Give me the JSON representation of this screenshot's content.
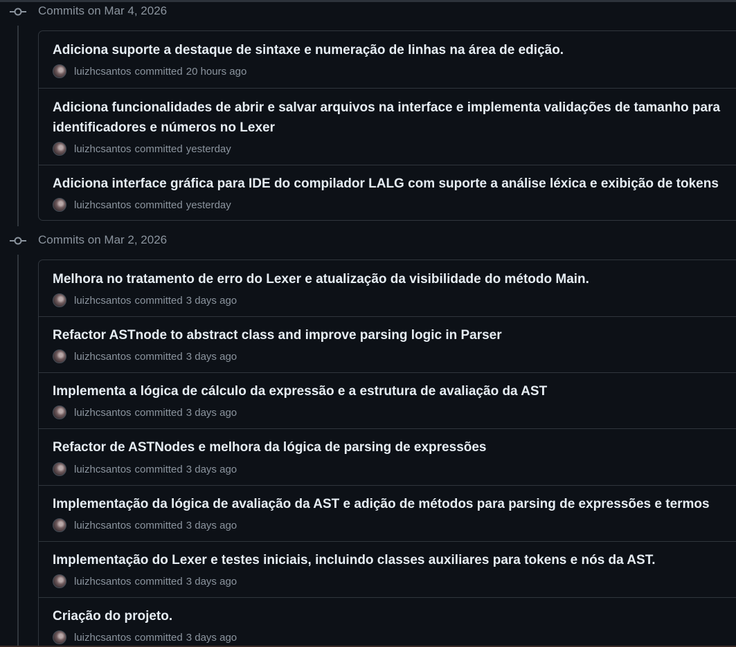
{
  "groups": [
    {
      "title": "Commits on Mar 4, 2026",
      "commits": [
        {
          "message": "Adiciona suporte a destaque de sintaxe e numeração de linhas na área de edição.",
          "author": "luizhcsantos",
          "verb": "committed",
          "time": "20 hours ago"
        },
        {
          "message": "Adiciona funcionalidades de abrir e salvar arquivos na interface e implementa validações de tamanho para identificadores e números no Lexer",
          "author": "luizhcsantos",
          "verb": "committed",
          "time": "yesterday"
        },
        {
          "message": "Adiciona interface gráfica para IDE do compilador LALG com suporte a análise léxica e exibição de tokens",
          "author": "luizhcsantos",
          "verb": "committed",
          "time": "yesterday"
        }
      ]
    },
    {
      "title": "Commits on Mar 2, 2026",
      "commits": [
        {
          "message": "Melhora no tratamento de erro do Lexer e atualização da visibilidade do método Main.",
          "author": "luizhcsantos",
          "verb": "committed",
          "time": "3 days ago"
        },
        {
          "message": "Refactor ASTnode to abstract class and improve parsing logic in Parser",
          "author": "luizhcsantos",
          "verb": "committed",
          "time": "3 days ago"
        },
        {
          "message": "Implementa a lógica de cálculo da expressão e a estrutura de avaliação da AST",
          "author": "luizhcsantos",
          "verb": "committed",
          "time": "3 days ago"
        },
        {
          "message": "Refactor de ASTNodes e melhora da lógica de parsing de expressões",
          "author": "luizhcsantos",
          "verb": "committed",
          "time": "3 days ago"
        },
        {
          "message": "Implementação da lógica de avaliação da AST e adição de métodos para parsing de expressões e termos",
          "author": "luizhcsantos",
          "verb": "committed",
          "time": "3 days ago"
        },
        {
          "message": "Implementação do Lexer e testes iniciais, incluindo classes auxiliares para tokens e nós da AST.",
          "author": "luizhcsantos",
          "verb": "committed",
          "time": "3 days ago"
        },
        {
          "message": "Criação do projeto.",
          "author": "luizhcsantos",
          "verb": "committed",
          "time": "3 days ago"
        }
      ]
    }
  ]
}
